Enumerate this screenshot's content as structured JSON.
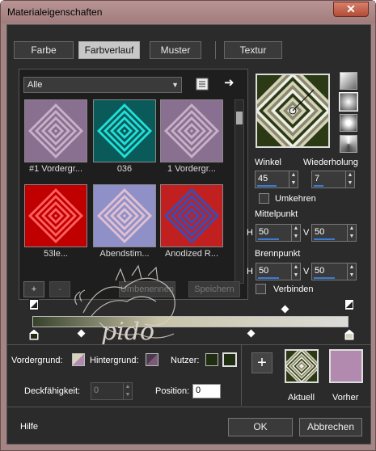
{
  "window": {
    "title": "Materialeigenschaften",
    "close": "✕"
  },
  "tabs": [
    {
      "label": "Farbe"
    },
    {
      "label": "Farbverlauf"
    },
    {
      "label": "Muster"
    },
    {
      "label": "Textur"
    }
  ],
  "category": {
    "value": "Alle"
  },
  "thumbs": [
    {
      "label": "#1 Vordergr...",
      "colors": [
        "#8a7090",
        "#c8b0c8"
      ]
    },
    {
      "label": "036",
      "colors": [
        "#0a5a5a",
        "#20e0d8"
      ]
    },
    {
      "label": "1 Vordergr...",
      "colors": [
        "#8a7090",
        "#c8b0c8"
      ]
    },
    {
      "label": "53le...",
      "colors": [
        "#c00000",
        "#ff6060"
      ]
    },
    {
      "label": "Abendstim...",
      "colors": [
        "#9090c8",
        "#e0c0d0"
      ]
    },
    {
      "label": "Anodized R...",
      "colors": [
        "#c02020",
        "#3050c0"
      ]
    }
  ],
  "list_buttons": {
    "add": "+",
    "remove": "-",
    "rename": "Umbenennen",
    "save": "Speichern"
  },
  "angle": {
    "label": "Winkel",
    "value": "45"
  },
  "repeat": {
    "label": "Wiederholung",
    "value": "7"
  },
  "invert": {
    "label": "Umkehren"
  },
  "center": {
    "label": "Mittelpunkt",
    "h_label": "H",
    "h_value": "50",
    "v_label": "V",
    "v_value": "50"
  },
  "focus": {
    "label": "Brennpunkt",
    "h_label": "H",
    "h_value": "50",
    "v_label": "V",
    "v_value": "50"
  },
  "link": {
    "label": "Verbinden"
  },
  "bottom": {
    "foreground": "Vordergrund:",
    "background": "Hintergrund:",
    "user": "Nutzer:",
    "opacity_label": "Deckfähigkeit:",
    "opacity_value": "0",
    "position_label": "Position:",
    "position_value": "0",
    "plus": "+",
    "current": "Aktuell",
    "previous": "Vorher"
  },
  "footer": {
    "help": "Hilfe",
    "ok": "OK",
    "cancel": "Abbrechen"
  },
  "colors": {
    "preview_dark": "#2b3a14",
    "preview_light": "#d6d2bd",
    "previous_swatch": "#b28ab0",
    "user_swatch": "#1f2d10"
  },
  "watermark": {
    "text": "pido"
  }
}
